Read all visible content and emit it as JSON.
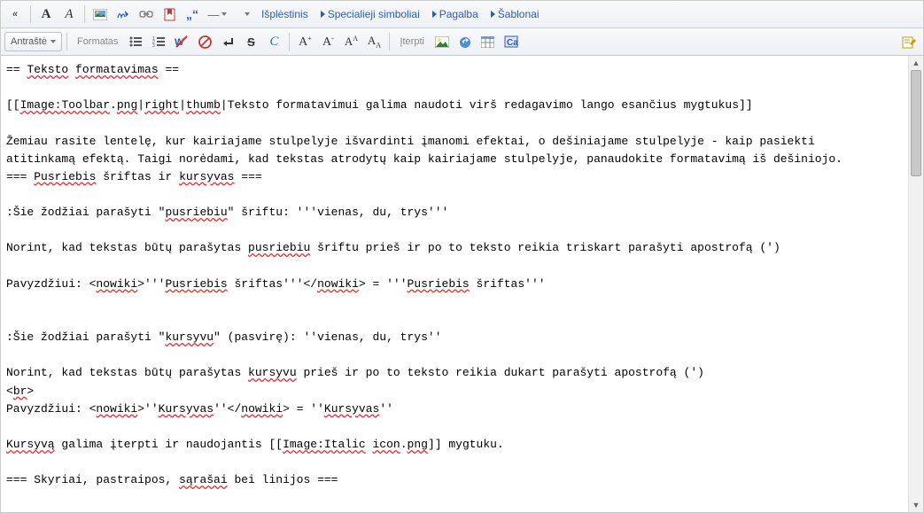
{
  "toolbar1": {
    "collapse": "«",
    "bold": "A",
    "italic": "A",
    "menus": {
      "isplestinis": "Išplėstinis",
      "specialieji": "Specialieji simboliai",
      "pagalba": "Pagalba",
      "sablonai": "Šablonai"
    }
  },
  "toolbar2": {
    "antraste": "Antraštė",
    "formatas": "Formatas",
    "iterpti": "Įterpti"
  },
  "editor": {
    "l1a": "== ",
    "l1b": "Teksto",
    "l1c": " ",
    "l1d": "formatavimas",
    "l1e": " ==",
    "l2": "",
    "l3a": "[[",
    "l3b": "Image:Toolbar",
    "l3c": ".",
    "l3d": "png",
    "l3e": "|",
    "l3f": "right",
    "l3g": "|",
    "l3h": "thumb",
    "l3i": "|Teksto formatavimui galima naudoti virš redagavimo lango esančius mygtukus]]",
    "l4": "",
    "l5": "Žemiau rasite lentelę, kur kairiajame stulpelyje išvardinti įmanomi efektai, o dešiniajame stulpelyje - kaip pasiekti",
    "l6": "atitinkamą efektą. Taigi norėdami, kad tekstas atrodytų kaip kairiajame stulpelyje, panaudokite formatavimą iš dešiniojo.",
    "l7a": "=== ",
    "l7b": "Pusriebis",
    "l7c": " šriftas ir ",
    "l7d": "kursyvas",
    "l7e": " ===",
    "l8": "",
    "l9a": ":Šie žodžiai parašyti \"",
    "l9b": "pusriebiu",
    "l9c": "\" šriftu: '''vienas, du, trys'''",
    "l10": "",
    "l11a": "Norint, kad tekstas būtų parašytas ",
    "l11b": "pusriebiu",
    "l11c": " šriftu prieš ir po to teksto reikia triskart parašyti apostrofą (')",
    "l12": "",
    "l13a": "Pavyzdžiui: <",
    "l13b": "nowiki",
    "l13c": ">'''",
    "l13d": "Pusriebis",
    "l13e": " šriftas'''</",
    "l13f": "nowiki",
    "l13g": "> = '''",
    "l13h": "Pusriebis",
    "l13i": " šriftas'''",
    "l14": "",
    "l15": "",
    "l16a": ":Šie žodžiai parašyti \"",
    "l16b": "kursyvu",
    "l16c": "\" (pasvirę): ''vienas, du, trys''",
    "l17": "",
    "l18a": "Norint, kad tekstas būtų parašytas ",
    "l18b": "kursyvu",
    "l18c": " prieš ir po to teksto reikia dukart parašyti apostrofą (')",
    "l19a": "<",
    "l19b": "br",
    "l19c": ">",
    "l20a": "Pavyzdžiui: <",
    "l20b": "nowiki",
    "l20c": ">''",
    "l20d": "Kursyvas",
    "l20e": "''</",
    "l20f": "nowiki",
    "l20g": "> = ''",
    "l20h": "Kursyvas",
    "l20i": "''",
    "l21": "",
    "l22a": "Kursyvą",
    "l22b": " galima įterpti ir naudojantis [[",
    "l22c": "Image:Italic",
    "l22d": " ",
    "l22e": "icon",
    "l22f": ".",
    "l22g": "png",
    "l22h": "]] mygtuku.",
    "l23": "",
    "l24a": "=== Skyriai, pastraipos, ",
    "l24b": "sąrašai",
    "l24c": " bei linijos ==="
  }
}
